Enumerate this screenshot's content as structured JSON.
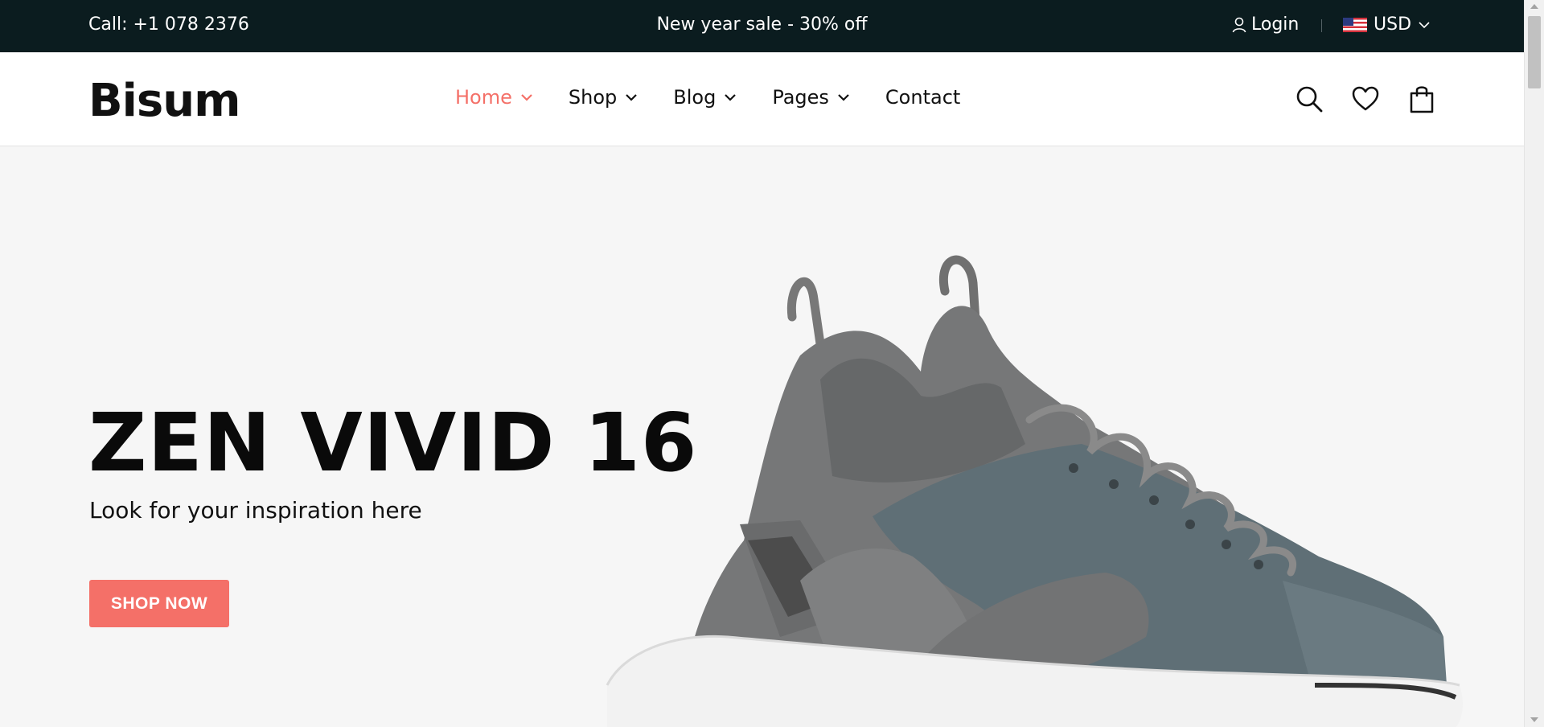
{
  "topbar": {
    "call": "Call: +1 078 2376",
    "promo": "New year sale - 30% off",
    "login": "Login",
    "currency": "USD"
  },
  "header": {
    "logo": "Bisum",
    "nav": [
      {
        "label": "Home",
        "active": true
      },
      {
        "label": "Shop"
      },
      {
        "label": "Blog"
      },
      {
        "label": "Pages"
      },
      {
        "label": "Contact"
      }
    ],
    "icons": [
      "search-icon",
      "heart-icon",
      "cart-bag-icon"
    ]
  },
  "hero": {
    "title": "ZEN VIVID 16",
    "subtitle": "Look for your inspiration here",
    "button": "SHOP NOW",
    "image": "grey-sneaker-image"
  },
  "colors": {
    "topbar_bg": "#0b1c1f",
    "accent": "#f47068",
    "hero_bg": "#f6f6f6"
  }
}
